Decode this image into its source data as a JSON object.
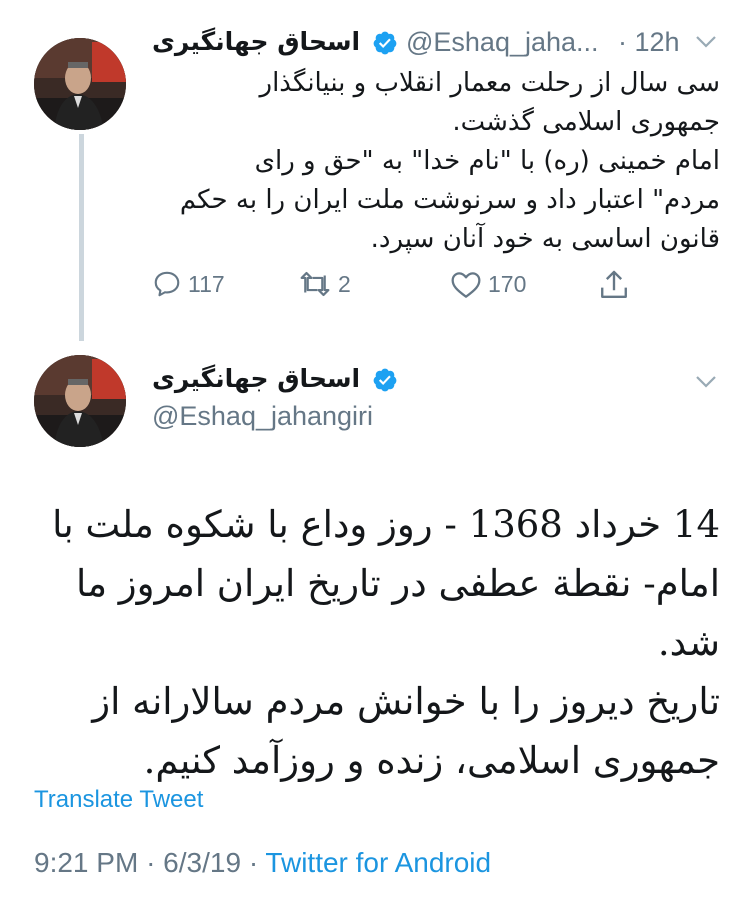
{
  "tweet_parent": {
    "author_name": "اسحاق جهانگیری",
    "handle": "@Eshaq_jaha...",
    "time": "· 12h",
    "lines": [
      "سی سال از رحلت معمار انقلاب و بنیانگذار",
      "جمهوری اسلامی گذشت.",
      "امام خمینی (ره) با \"نام خدا\" به \"حق و رای",
      "مردم\" اعتبار داد و سرنوشت ملت ایران را به حکم",
      "قانون اساسی به خود آنان سپرد."
    ],
    "actions": {
      "reply_count": "117",
      "retweet_count": "2",
      "like_count": "170"
    }
  },
  "tweet_main": {
    "author_name": "اسحاق جهانگیری",
    "handle": "@Eshaq_jahangiri",
    "lines": [
      "14 خرداد 1368 - روز وداع با شکوه ملت با",
      "امام- نقطة عطفی در تاریخ ایران امروز ما شد.",
      "تاریخ دیروز را با خوانش مردم سالارانه از",
      "جمهوری اسلامی، زنده و روزآمد کنیم."
    ],
    "translate_label": "Translate Tweet",
    "time": "9:21 PM",
    "date": "6/3/19",
    "source": "Twitter for Android"
  },
  "colors": {
    "accent": "#1b95e0",
    "muted": "#657786",
    "verified": "#1da1f2"
  },
  "icons": [
    "verified-badge-icon",
    "chevron-down-icon",
    "reply-icon",
    "retweet-icon",
    "like-icon",
    "share-icon"
  ]
}
